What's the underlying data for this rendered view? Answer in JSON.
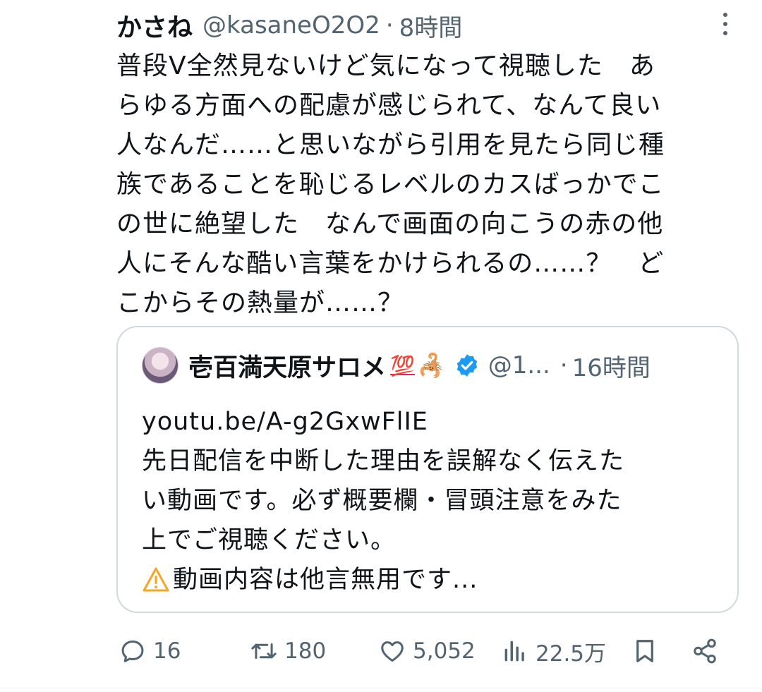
{
  "tweet": {
    "display_name": "かさね",
    "handle": "@kasaneO2O2",
    "separator": "·",
    "time": "8時間",
    "body_lines": [
      "普段V全然見ないけど気になって視聴した　あ",
      "らゆる方面への配慮が感じられて、なんて良い",
      "人なんだ……と思いながら引用を見たら同じ種",
      "族であることを恥じるレベルのカスばっかでこ",
      "の世に絶望した　なんで画面の向こうの赤の他",
      "人にそんな酷い言葉をかけられるの……？　ど",
      "こからその熱量が……？"
    ]
  },
  "quote": {
    "display_name": "壱百満天原サロメ",
    "emoji_1": "💯",
    "emoji_2": "🦂",
    "handle": "@1...",
    "separator": "·",
    "time": "16時間",
    "body_lines": [
      "youtu.be/A-g2GxwFlIE",
      "先日配信を中断した理由を誤解なく伝えた",
      "い動画です。必ず概要欄・冒頭注意をみた",
      "上でご視聴ください。"
    ],
    "warning_text": "動画内容は他言無用です..."
  },
  "actions": {
    "replies": "16",
    "retweets": "180",
    "likes": "5,052",
    "views": "22.5万"
  },
  "colors": {
    "text": "#0f1419",
    "secondary": "#536471",
    "verified": "#1d9bf0",
    "border": "#cfd9de",
    "warning": "#f5a623"
  },
  "icons": [
    "more-icon",
    "verified-badge-icon",
    "warning-icon",
    "reply-icon",
    "retweet-icon",
    "like-icon",
    "views-icon",
    "bookmark-icon",
    "share-icon"
  ]
}
